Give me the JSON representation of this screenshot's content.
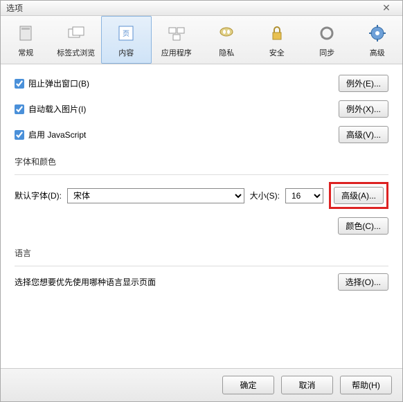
{
  "title": "选项",
  "toolbar": [
    {
      "label": "常规",
      "icon": "general"
    },
    {
      "label": "标签式浏览",
      "icon": "tabs"
    },
    {
      "label": "内容",
      "icon": "content",
      "active": true
    },
    {
      "label": "应用程序",
      "icon": "apps"
    },
    {
      "label": "隐私",
      "icon": "privacy"
    },
    {
      "label": "安全",
      "icon": "security"
    },
    {
      "label": "同步",
      "icon": "sync"
    },
    {
      "label": "高级",
      "icon": "advanced"
    }
  ],
  "checks": {
    "popup": {
      "label": "阻止弹出窗口(B)",
      "btn": "例外(E)..."
    },
    "images": {
      "label": "自动载入图片(I)",
      "btn": "例外(X)..."
    },
    "js": {
      "label": "启用 JavaScript",
      "btn": "高级(V)..."
    }
  },
  "font_section": {
    "title": "字体和颜色",
    "default_label": "默认字体(D):",
    "font_value": "宋体",
    "size_label": "大小(S):",
    "size_value": "16",
    "advanced_btn": "高级(A)...",
    "color_btn": "颜色(C)..."
  },
  "lang_section": {
    "title": "语言",
    "desc": "选择您想要优先使用哪种语言显示页面",
    "btn": "选择(O)..."
  },
  "footer": {
    "ok": "确定",
    "cancel": "取消",
    "help": "帮助(H)"
  }
}
